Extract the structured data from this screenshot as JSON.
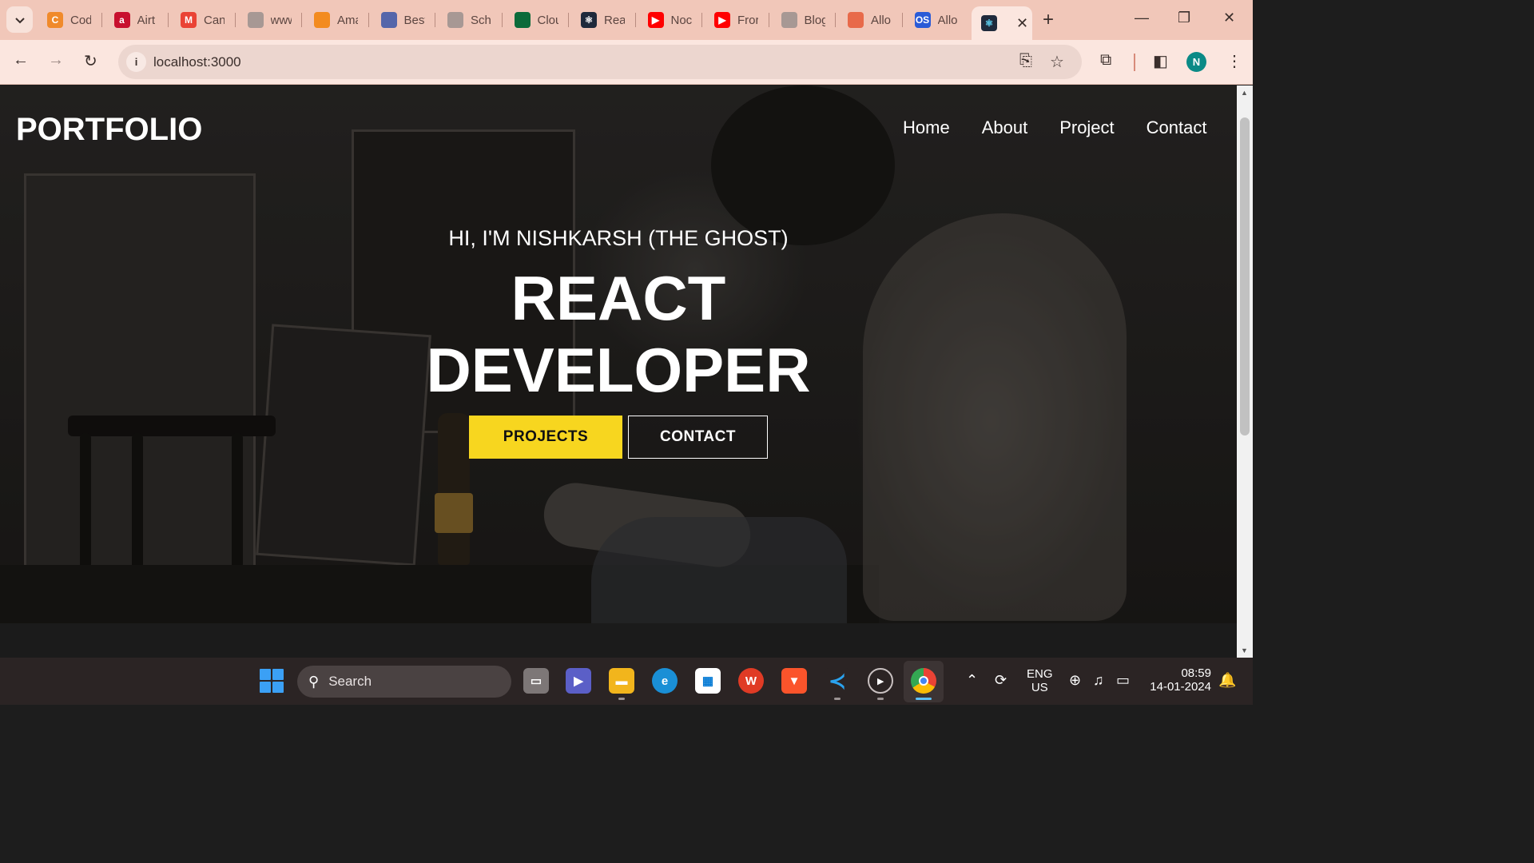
{
  "browser": {
    "tabs": [
      {
        "label": "Cod",
        "icon": "codechef-icon",
        "color": "#f08a2b",
        "glyph": "C"
      },
      {
        "label": "Airt",
        "icon": "airtel-icon",
        "color": "#c8102e",
        "glyph": "a"
      },
      {
        "label": "Can",
        "icon": "gmail-icon",
        "color": "#ea4335",
        "glyph": "M"
      },
      {
        "label": "www",
        "icon": "globe-icon",
        "color": "#a79894",
        "glyph": ""
      },
      {
        "label": "Ama",
        "icon": "box-icon",
        "color": "#f38b1f",
        "glyph": ""
      },
      {
        "label": "Best",
        "icon": "site-icon",
        "color": "#5566aa",
        "glyph": ""
      },
      {
        "label": "Sch",
        "icon": "globe-icon",
        "color": "#a79894",
        "glyph": ""
      },
      {
        "label": "Clou",
        "icon": "mongodb-icon",
        "color": "#0b6b3a",
        "glyph": ""
      },
      {
        "label": "Rea",
        "icon": "react-icon",
        "color": "#1f2a3c",
        "glyph": "⚛"
      },
      {
        "label": "Noc",
        "icon": "youtube-icon",
        "color": "#ff0000",
        "glyph": "▶"
      },
      {
        "label": "Fror",
        "icon": "youtube-icon",
        "color": "#ff0000",
        "glyph": "▶"
      },
      {
        "label": "Blog",
        "icon": "globe-icon",
        "color": "#a79894",
        "glyph": ""
      },
      {
        "label": "Allo",
        "icon": "rainbow-icon",
        "color": "#e86a4a",
        "glyph": ""
      },
      {
        "label": "Allo",
        "icon": "os-icon",
        "color": "#2a5bd7",
        "glyph": "OS"
      }
    ],
    "active_tab": {
      "icon": "react-icon",
      "close": "✕"
    },
    "new_tab": "+",
    "url": "localhost:3000",
    "profile_initial": "N"
  },
  "page": {
    "logo": "PORTFOLIO",
    "nav": [
      "Home",
      "About",
      "Project",
      "Contact"
    ],
    "greeting": "HI, I'M NISHKARSH (THE GHOST)",
    "title_line1": "REACT",
    "title_line2": "DEVELOPER",
    "btn_projects": "PROJECTS",
    "btn_contact": "CONTACT",
    "accent": "#f7d61f"
  },
  "taskbar": {
    "search_placeholder": "Search",
    "lang_line1": "ENG",
    "lang_line2": "US",
    "time": "08:59",
    "date": "14-01-2024"
  }
}
